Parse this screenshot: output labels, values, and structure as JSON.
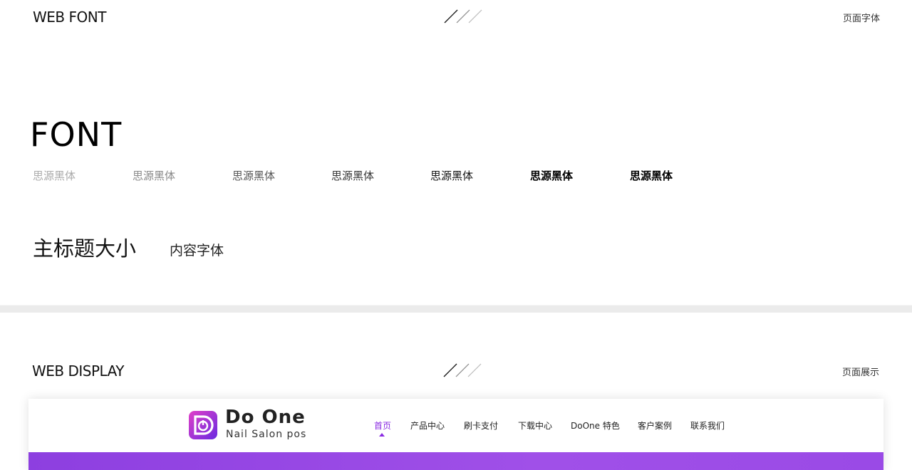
{
  "font_section": {
    "title": "WEB FONT",
    "subtitle": "页面字体",
    "big_label": "FONT",
    "weights": [
      {
        "label": "思源黑体",
        "color": "#aaaaaa",
        "weight": 200
      },
      {
        "label": "思源黑体",
        "color": "#888888",
        "weight": 300
      },
      {
        "label": "思源黑体",
        "color": "#555555",
        "weight": 400
      },
      {
        "label": "思源黑体",
        "color": "#333333",
        "weight": 400
      },
      {
        "label": "思源黑体",
        "color": "#111111",
        "weight": 500
      },
      {
        "label": "思源黑体",
        "color": "#000000",
        "weight": 700
      },
      {
        "label": "思源黑体",
        "color": "#000000",
        "weight": 800
      }
    ],
    "heading_sample": "主标题大小",
    "content_sample": "内容字体"
  },
  "display_section": {
    "title": "WEB DISPLAY",
    "subtitle": "页面展示"
  },
  "preview": {
    "brand_name": "Do One",
    "brand_tagline": "Nail Salon pos",
    "nav": [
      "首页",
      "产品中心",
      "刷卡支付",
      "下载中心",
      "DoOne 特色",
      "客户案例",
      "联系我们"
    ],
    "active_nav_index": 0,
    "accent_color": "#8a2be2"
  }
}
